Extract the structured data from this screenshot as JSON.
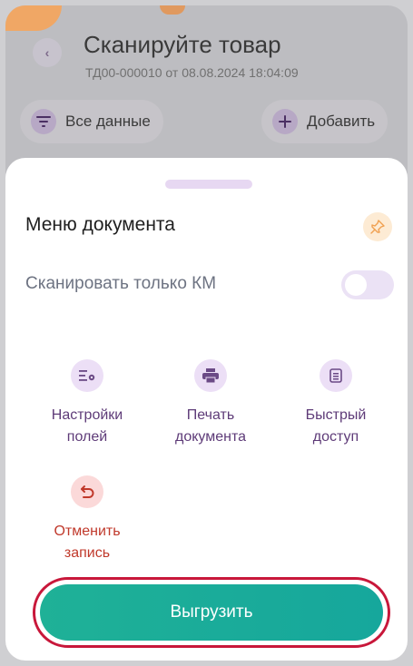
{
  "header": {
    "title": "Сканируйте товар",
    "subtitle": "ТД00-000010 от 08.08.2024 18:04:09",
    "back_icon": "chevron-left-icon"
  },
  "toolbar": {
    "all_data_label": "Все данные",
    "add_label": "Добавить"
  },
  "sheet": {
    "title": "Меню документа",
    "scan_only_km_label": "Сканировать только КМ",
    "scan_only_km_enabled": false,
    "actions": [
      {
        "label_line1": "Настройки",
        "label_line2": "полей",
        "icon": "field-settings-icon"
      },
      {
        "label_line1": "Печать",
        "label_line2": "документа",
        "icon": "printer-icon"
      },
      {
        "label_line1": "Быстрый",
        "label_line2": "доступ",
        "icon": "quick-access-icon"
      },
      {
        "label_line1": "Отменить",
        "label_line2": "запись",
        "icon": "undo-icon"
      }
    ],
    "upload_label": "Выгрузить"
  },
  "colors": {
    "accent_purple": "#5e3b78",
    "upload_green": "#1fb197",
    "danger_red": "#c0392b",
    "highlight_border": "#c8173a"
  }
}
